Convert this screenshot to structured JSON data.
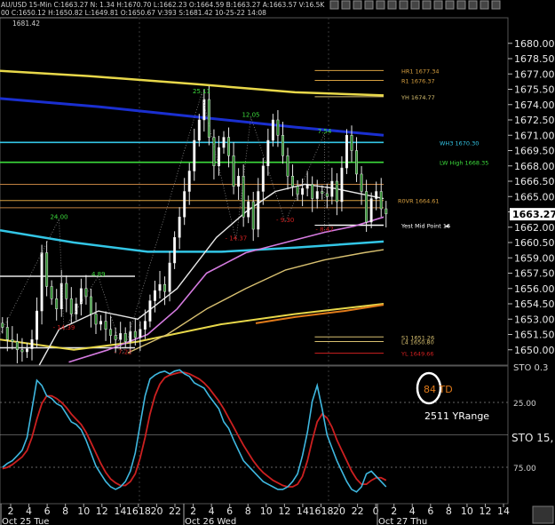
{
  "header": {
    "symbol": "AU/USD 15-Min",
    "line1": "AU/USD 15-Min  C:1663.27  N:  1.34  H:1670.70  L:1662.23  O:1664.59  B:1663.27  A:1663.57  V:16.5K",
    "line2": "00  C:1650.12  H:1650.82  L:1649.81  O:1650.67  V:393  S:1681.42  10-25-22  14:08",
    "top_left_price": "1681.42"
  },
  "colors": {
    "background": "#000000",
    "candle": "#2f8f2f",
    "gold_ma": "#e8d84a",
    "blue_ma": "#1a2fd0",
    "cyan_ma": "#33c6e6",
    "pink_ma": "#d57be0",
    "white_line": "#e8e8e8",
    "khaki_line": "#d8c070",
    "orange_ma": "#e07a1a",
    "stoch_k": "#3fb8e0",
    "stoch_d": "#cc2020",
    "price_box": "#ffffff"
  },
  "chart_data": [
    {
      "type": "line",
      "name": "price",
      "ylim": [
        1648.5,
        1682.5
      ],
      "xlim": [
        0,
        78
      ],
      "yticks": [
        1680.0,
        1678.5,
        1677.0,
        1675.5,
        1674.0,
        1672.5,
        1671.0,
        1669.5,
        1668.0,
        1666.5,
        1665.0,
        1663.5,
        1662.0,
        1660.5,
        1659.0,
        1657.5,
        1656.0,
        1654.5,
        1653.0,
        1651.5,
        1650.0
      ],
      "current_price": "1663.27",
      "close": [
        1652.2,
        1651.0,
        1650.8,
        1650.0,
        1649.8,
        1650.1,
        1651.0,
        1653.8,
        1659.5,
        1656.2,
        1655.0,
        1654.0,
        1656.5,
        1655.0,
        1653.5,
        1654.5,
        1656.0,
        1655.2,
        1653.5,
        1652.5,
        1652.8,
        1652.0,
        1651.4,
        1651.0,
        1651.6,
        1650.8,
        1651.8,
        1651.2,
        1652.0,
        1652.8,
        1654.8,
        1655.8,
        1656.4,
        1655.7,
        1658.5,
        1661.0,
        1663.0,
        1665.5,
        1667.5,
        1670.5,
        1672.5,
        1674.5,
        1670.8,
        1668.0,
        1669.8,
        1670.8,
        1669.0,
        1666.0,
        1667.0,
        1663.0,
        1664.5,
        1661.8,
        1665.5,
        1668.0,
        1670.5,
        1672.5,
        1671.0,
        1669.0,
        1667.0,
        1666.0,
        1665.2,
        1665.8,
        1666.2,
        1664.8,
        1665.5,
        1665.3,
        1665.0,
        1666.5,
        1664.5,
        1667.8,
        1671.0,
        1669.5,
        1667.2,
        1665.5,
        1662.5,
        1664.8,
        1665.5,
        1663.8,
        1663.3
      ],
      "series_lines": [
        {
          "key": "gold",
          "values": [
            [
              0,
              1677.3
            ],
            [
              18,
              1676.8
            ],
            [
              40,
              1676.0
            ],
            [
              60,
              1675.2
            ],
            [
              78,
              1674.9
            ]
          ]
        },
        {
          "key": "blue",
          "values": [
            [
              0,
              1674.6
            ],
            [
              20,
              1673.8
            ],
            [
              40,
              1672.8
            ],
            [
              60,
              1671.8
            ],
            [
              78,
              1671.0
            ]
          ]
        },
        {
          "key": "cyan",
          "values": [
            [
              0,
              1661.7
            ],
            [
              15,
              1660.5
            ],
            [
              30,
              1659.6
            ],
            [
              45,
              1659.6
            ],
            [
              60,
              1660.0
            ],
            [
              78,
              1660.6
            ]
          ]
        },
        {
          "key": "gold2",
          "values": [
            [
              0,
              1651.0
            ],
            [
              15,
              1650.0
            ],
            [
              28,
              1650.8
            ],
            [
              45,
              1652.5
            ],
            [
              60,
              1653.5
            ],
            [
              78,
              1654.5
            ]
          ]
        },
        {
          "key": "orange",
          "values": [
            [
              52,
              1652.6
            ],
            [
              60,
              1653.2
            ],
            [
              70,
              1653.8
            ],
            [
              78,
              1654.4
            ]
          ]
        },
        {
          "key": "pink",
          "values": [
            [
              14,
              1648.8
            ],
            [
              22,
              1650.0
            ],
            [
              30,
              1651.5
            ],
            [
              36,
              1654.0
            ],
            [
              42,
              1657.5
            ],
            [
              50,
              1659.5
            ],
            [
              58,
              1660.5
            ],
            [
              66,
              1661.5
            ],
            [
              72,
              1662.1
            ],
            [
              78,
              1663.0
            ]
          ]
        },
        {
          "key": "khaki",
          "values": [
            [
              26,
              1649.7
            ],
            [
              34,
              1651.5
            ],
            [
              42,
              1654.0
            ],
            [
              50,
              1656.0
            ],
            [
              58,
              1657.8
            ],
            [
              66,
              1658.8
            ],
            [
              74,
              1659.5
            ],
            [
              78,
              1659.8
            ]
          ]
        },
        {
          "key": "white",
          "values": [
            [
              8,
              1648.5
            ],
            [
              12,
              1652.0
            ],
            [
              20,
              1653.8
            ],
            [
              28,
              1653.0
            ],
            [
              36,
              1656.0
            ],
            [
              44,
              1661.0
            ],
            [
              50,
              1663.5
            ],
            [
              56,
              1665.5
            ],
            [
              62,
              1666.2
            ],
            [
              68,
              1665.8
            ],
            [
              74,
              1665.2
            ],
            [
              78,
              1664.8
            ]
          ]
        }
      ],
      "levels": [
        {
          "label": "HR1 1677.34",
          "value": 1677.34,
          "from": 64,
          "color": "#d8a040"
        },
        {
          "label": "R1 1676.37",
          "value": 1676.37,
          "from": 64,
          "color": "#d8a040"
        },
        {
          "label": "YH 1674.77",
          "value": 1674.77,
          "from": 64,
          "color": "#d8c070"
        },
        {
          "label": "WH3 1670.30",
          "value": 1670.3,
          "from": 0,
          "color": "#33c6e6"
        },
        {
          "label": "LW High 1668.35",
          "value": 1668.35,
          "from": 0,
          "color": "#3cdc3c"
        },
        {
          "label": "R0VR 1664.61",
          "value": 1664.61,
          "from": 0,
          "color": "#d8a040"
        },
        {
          "label": "",
          "value": 1666.2,
          "from": 0,
          "color": "#c08040"
        },
        {
          "label": "",
          "value": 1663.9,
          "from": 0,
          "color": "#c08040"
        },
        {
          "label": "Yest Mid Point 16",
          "value": 1662.2,
          "from": 64,
          "color": "#ffffff"
        },
        {
          "label": "S1 1651.26",
          "value": 1651.26,
          "from": 64,
          "color": "#d8c070"
        },
        {
          "label": "L4 1650.80",
          "value": 1650.8,
          "from": 64,
          "color": "#d8c070"
        },
        {
          "label": "YL 1649.66",
          "value": 1649.66,
          "from": 64,
          "color": "#d02020"
        }
      ],
      "annotations": [
        {
          "text": "24.00",
          "x": 12,
          "y": 1662.8,
          "color": "#3cdc3c"
        },
        {
          "text": "4.89",
          "x": 20,
          "y": 1657.2,
          "color": "#3cdc3c"
        },
        {
          "text": "- 14.39",
          "x": 13,
          "y": 1652.0,
          "color": "#d02020"
        },
        {
          "text": "- 7.22",
          "x": 25,
          "y": 1649.6,
          "color": "#d02020"
        },
        {
          "text": "25.11",
          "x": 41,
          "y": 1675.1,
          "color": "#3cdc3c"
        },
        {
          "text": "- 14.37",
          "x": 48,
          "y": 1660.7,
          "color": "#d02020"
        },
        {
          "text": "12.05",
          "x": 51,
          "y": 1672.8,
          "color": "#3cdc3c"
        },
        {
          "text": "7.54",
          "x": 66,
          "y": 1671.2,
          "color": "#3cdc3c"
        },
        {
          "text": "- 9.30",
          "x": 58,
          "y": 1662.5,
          "color": "#d02020"
        },
        {
          "text": "- 8.47",
          "x": 66,
          "y": 1661.6,
          "color": "#d02020"
        }
      ]
    },
    {
      "type": "line",
      "name": "stochastic",
      "ylim": [
        -3,
        103
      ],
      "yticks": [
        {
          "value": 75,
          "label": "25.00"
        },
        {
          "value": 25,
          "label": "75.00"
        }
      ],
      "label": "STO 15,",
      "k": [
        25,
        28,
        30,
        34,
        38,
        48,
        70,
        92,
        88,
        80,
        78,
        74,
        72,
        66,
        60,
        58,
        54,
        46,
        36,
        26,
        20,
        14,
        10,
        8,
        10,
        14,
        22,
        36,
        58,
        80,
        93,
        96,
        98,
        99,
        97,
        99,
        100,
        97,
        95,
        90,
        88,
        86,
        80,
        75,
        70,
        60,
        55,
        46,
        38,
        30,
        26,
        22,
        18,
        14,
        12,
        10,
        8,
        8,
        10,
        14,
        20,
        34,
        52,
        76,
        88,
        70,
        50,
        40,
        30,
        22,
        14,
        8,
        6,
        10,
        20,
        22,
        18,
        14,
        10
      ],
      "d": [
        24,
        25,
        27,
        30,
        33,
        38,
        48,
        62,
        74,
        80,
        80,
        78,
        75,
        71,
        66,
        62,
        58,
        52,
        44,
        36,
        28,
        21,
        16,
        13,
        11,
        11,
        14,
        20,
        32,
        48,
        66,
        80,
        89,
        94,
        96,
        97,
        98,
        98,
        97,
        95,
        93,
        90,
        86,
        81,
        76,
        70,
        63,
        56,
        49,
        42,
        36,
        30,
        25,
        21,
        18,
        15,
        13,
        11,
        10,
        10,
        12,
        18,
        30,
        46,
        60,
        66,
        63,
        56,
        46,
        38,
        30,
        22,
        16,
        12,
        12,
        15,
        17,
        17,
        15
      ]
    }
  ],
  "overlays": {
    "td_text": "84 TD",
    "range_text": "2511 YRange",
    "stoch_label_top": "STO 0.3"
  },
  "x_axis": {
    "labels": [
      "2",
      "4",
      "6",
      "8",
      "10",
      "12",
      "14",
      "1618",
      "20",
      "22",
      "2",
      "4",
      "6",
      "8",
      "10",
      "12",
      "14",
      "1618",
      "20",
      "22",
      "0",
      "2",
      "4",
      "6",
      "8",
      "10",
      "12",
      "14"
    ],
    "date_labels": [
      "Oct 25 Tue",
      "Oct 26 Wed",
      "Oct 27 Thu"
    ]
  }
}
